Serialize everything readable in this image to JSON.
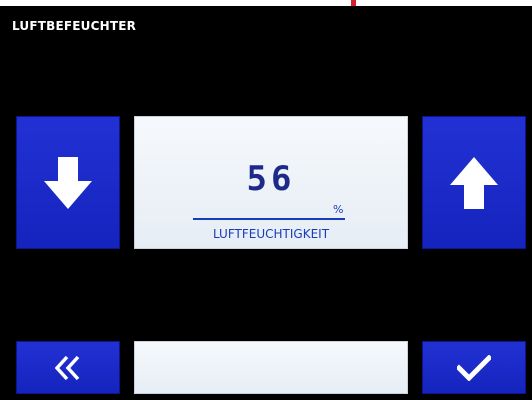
{
  "header": {
    "title": "LUFTBEFEUCHTER"
  },
  "display": {
    "value": "56",
    "unit": "%",
    "label": "LUFTFEUCHTIGKEIT"
  },
  "controls": {
    "decrease_icon": "arrow-down-icon",
    "increase_icon": "arrow-up-icon",
    "back_icon": "double-chevron-left-icon",
    "confirm_icon": "checkmark-icon"
  },
  "status": {
    "text": ""
  },
  "colors": {
    "background": "#000000",
    "button_blue": "#1a28c8",
    "panel": "#eef3f9",
    "value_text": "#1e2a8a",
    "accent_text": "#1a3cb8",
    "pointer_red": "#d42030"
  }
}
